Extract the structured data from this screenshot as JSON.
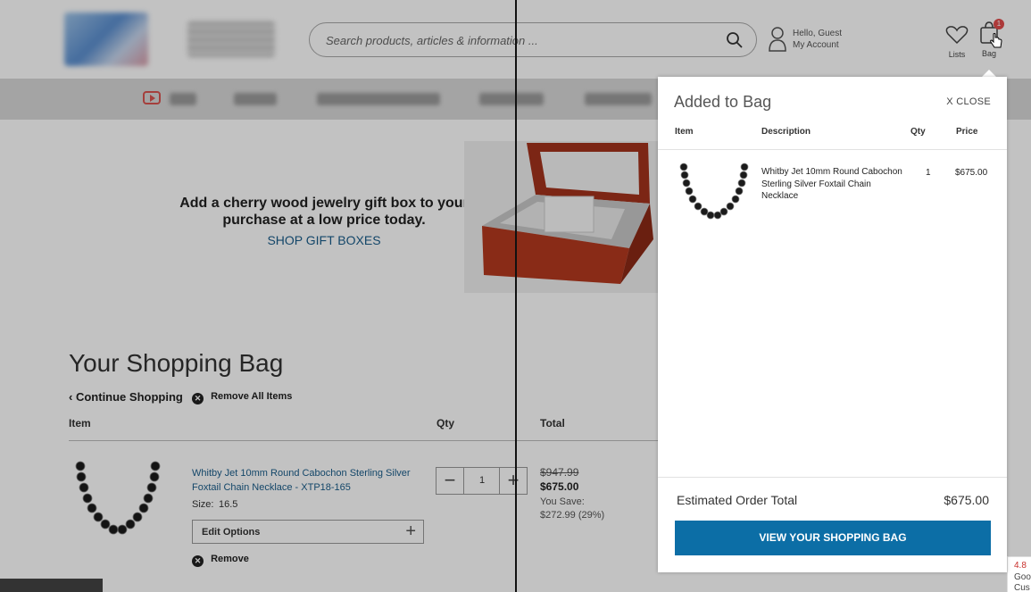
{
  "header": {
    "search_placeholder": "Search products, articles & information ...",
    "account_greeting": "Hello, Guest",
    "account_link": "My Account",
    "lists_label": "Lists",
    "bag_label": "Bag",
    "bag_count": "1"
  },
  "promo": {
    "text": "Add a cherry wood jewelry gift box to your purchase at a low price today.",
    "link": "SHOP GIFT BOXES"
  },
  "cart": {
    "title": "Your Shopping Bag",
    "continue_label": "Continue Shopping",
    "remove_all_label": "Remove All Items",
    "columns": {
      "item": "Item",
      "qty": "Qty",
      "total": "Total"
    },
    "row": {
      "name": "Whitby Jet 10mm Round Cabochon Sterling Silver Foxtail Chain Necklace - XTP18-165",
      "size_label": "Size:",
      "size_value": "16.5",
      "edit_options_label": "Edit Options",
      "remove_label": "Remove",
      "qty": "1",
      "price_original": "$947.99",
      "price_now": "$675.00",
      "you_save_label": "You Save:",
      "you_save_value": "$272.99 (29%)"
    }
  },
  "panel": {
    "title": "Added to Bag",
    "close_label": "X  CLOSE",
    "columns": {
      "item": "Item",
      "description": "Description",
      "qty": "Qty",
      "price": "Price"
    },
    "item": {
      "description": "Whitby Jet 10mm Round Cabochon Sterling Silver Foxtail Chain Necklace",
      "qty": "1",
      "price": "$675.00"
    },
    "estimated_label": "Estimated Order Total",
    "estimated_value": "$675.00",
    "view_bag_label": "VIEW YOUR SHOPPING BAG"
  },
  "rating_badge": {
    "score": "4.8",
    "line2": "Goo",
    "line3": "Cus"
  },
  "colors": {
    "accent": "#0c6ea6",
    "link": "#1a5d8a",
    "badge": "#e24b4b"
  }
}
